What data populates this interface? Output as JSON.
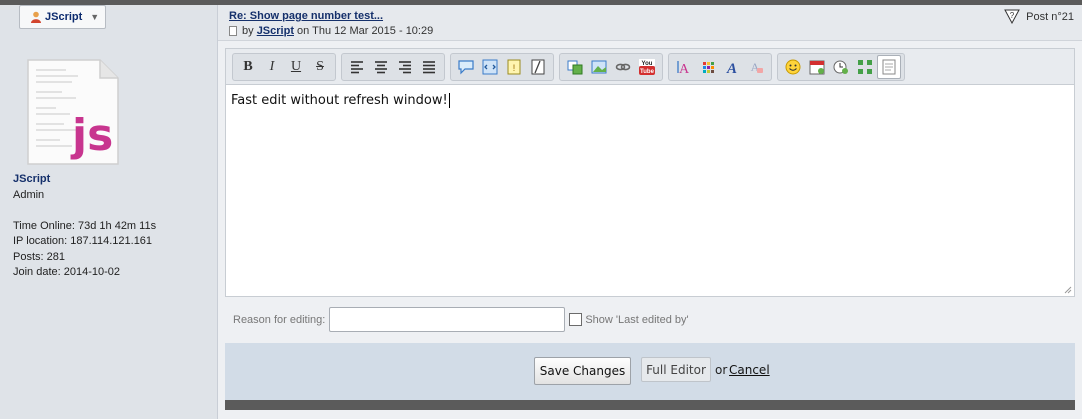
{
  "user_menu": {
    "label": "JScript",
    "icon": "user-icon"
  },
  "post": {
    "title": "Re: Show page number test...",
    "meta_prefix": "by",
    "author": "JScript",
    "date": "on Thu 12 Mar 2015 - 10:29",
    "number": "Post n°21"
  },
  "profile": {
    "name": "JScript",
    "rank": "Admin",
    "stats": [
      "Time Online: 73d 1h 42m 11s",
      "IP location: 187.114.121.161",
      "Posts: 281",
      "Join date: 2014-10-02"
    ]
  },
  "toolbar": {
    "groups": [
      [
        "bold-icon",
        "italic-icon",
        "underline-icon",
        "strikethrough-icon"
      ],
      [
        "align-left-icon",
        "align-center-icon",
        "align-right-icon",
        "justify-icon"
      ],
      [
        "quote-icon",
        "code-icon",
        "spoiler-icon",
        "hide-icon"
      ],
      [
        "table-icon",
        "image-icon",
        "link-icon",
        "youtube-icon"
      ],
      [
        "font-size-icon",
        "color-icon",
        "font-family-icon",
        "erase-format-icon"
      ],
      [
        "smiley-icon",
        "date-icon",
        "time-icon",
        "fullscreen-icon",
        "source-icon"
      ]
    ]
  },
  "editor": {
    "content": "Fast edit without refresh window!"
  },
  "reason": {
    "label": "Reason for editing:",
    "value": "",
    "show_label": "Show 'Last edited by'"
  },
  "actions": {
    "save": "Save Changes",
    "full_editor": "Full Editor",
    "or": "or",
    "cancel": "Cancel"
  },
  "colors": {
    "accent": "#15306b",
    "bar": "#5b5b5b",
    "action_bg": "#d2dce7"
  }
}
